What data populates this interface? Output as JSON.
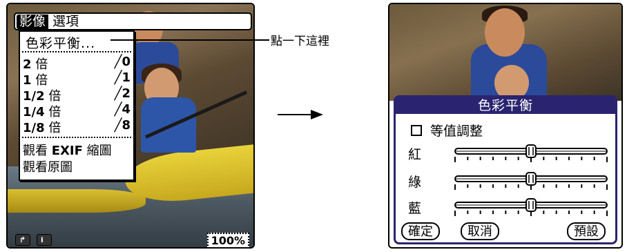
{
  "left": {
    "menubar": {
      "active": "影像",
      "second": "選項"
    },
    "dropdown": {
      "color_balance": "色彩平衡...",
      "zoom_items": [
        {
          "num": "2",
          "unit": "倍",
          "shortcut": "╱0"
        },
        {
          "num": "1",
          "unit": "倍",
          "shortcut": "╱1"
        },
        {
          "num": "1/2",
          "unit": "倍",
          "shortcut": "╱2"
        },
        {
          "num": "1/4",
          "unit": "倍",
          "shortcut": "╱4"
        },
        {
          "num": "1/8",
          "unit": "倍",
          "shortcut": "╱8"
        }
      ],
      "view_exif_pre": "觀看",
      "view_exif_bold": "EXIF",
      "view_exif_post": "縮圖",
      "view_original": "觀看原圖"
    },
    "zoom_level": "100%",
    "buttons": {
      "rotate_icon": "rotate-icon",
      "info_icon": "info-icon"
    }
  },
  "callout": {
    "text": "點一下這裡"
  },
  "right": {
    "dialog": {
      "title": "色彩平衡",
      "checkbox_label": "等值調整",
      "sliders": [
        {
          "label": "紅",
          "value": 0.5
        },
        {
          "label": "綠",
          "value": 0.5
        },
        {
          "label": "藍",
          "value": 0.5
        }
      ],
      "ok": "確定",
      "cancel": "取消",
      "preset": "預設"
    }
  },
  "colors": {
    "dialog_accent": "#2a2470"
  }
}
